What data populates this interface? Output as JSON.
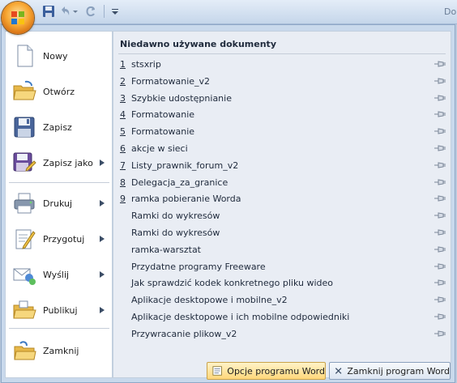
{
  "window": {
    "title": "Do"
  },
  "quick_access": {
    "icons": [
      "office-logo-icon",
      "save-icon",
      "undo-icon",
      "dropdown-arrow-icon",
      "redo-icon",
      "customize-icon"
    ]
  },
  "left_menu": {
    "items": [
      {
        "label": "Nowy",
        "icon": "new-document-icon",
        "has_submenu": false
      },
      {
        "label": "Otwórz",
        "icon": "open-folder-icon",
        "has_submenu": false
      },
      {
        "label": "Zapisz",
        "icon": "save-icon",
        "has_submenu": false
      },
      {
        "label": "Zapisz jako",
        "icon": "save-as-icon",
        "has_submenu": true
      },
      {
        "label": "Drukuj",
        "icon": "print-icon",
        "has_submenu": true
      },
      {
        "label": "Przygotuj",
        "icon": "prepare-icon",
        "has_submenu": true
      },
      {
        "label": "Wyślij",
        "icon": "send-icon",
        "has_submenu": true
      },
      {
        "label": "Publikuj",
        "icon": "publish-icon",
        "has_submenu": true
      },
      {
        "label": "Zamknij",
        "icon": "close-document-icon",
        "has_submenu": false
      }
    ]
  },
  "recent": {
    "header": "Niedawno używane dokumenty",
    "documents": [
      {
        "num": "1",
        "name": "stsxrip"
      },
      {
        "num": "2",
        "name": "Formatowanie_v2"
      },
      {
        "num": "3",
        "name": "Szybkie udostępnianie"
      },
      {
        "num": "4",
        "name": "Formatowanie"
      },
      {
        "num": "5",
        "name": "Formatowanie"
      },
      {
        "num": "6",
        "name": "akcje w sieci"
      },
      {
        "num": "7",
        "name": "Listy_prawnik_forum_v2"
      },
      {
        "num": "8",
        "name": "Delegacja_za_granice"
      },
      {
        "num": "9",
        "name": "ramka pobieranie Worda"
      },
      {
        "num": "",
        "name": "Ramki do wykresów"
      },
      {
        "num": "",
        "name": "Ramki do wykresów"
      },
      {
        "num": "",
        "name": "ramka-warsztat"
      },
      {
        "num": "",
        "name": "Przydatne programy Freeware"
      },
      {
        "num": "",
        "name": "Jak sprawdzić kodek konkretnego pliku wideo"
      },
      {
        "num": "",
        "name": "Aplikacje desktopowe i mobilne_v2"
      },
      {
        "num": "",
        "name": "Aplikacje desktopowe i ich mobilne odpowiedniki"
      },
      {
        "num": "",
        "name": "Przywracanie plikow_v2"
      }
    ]
  },
  "footer": {
    "options_label": "Opcje programu Word",
    "exit_label": "Zamknij program Word"
  },
  "colors": {
    "frame": "#c9d9ec",
    "left_panel": "#ffffff",
    "right_panel": "#e9edf4",
    "office_orange": "#f7a733"
  }
}
